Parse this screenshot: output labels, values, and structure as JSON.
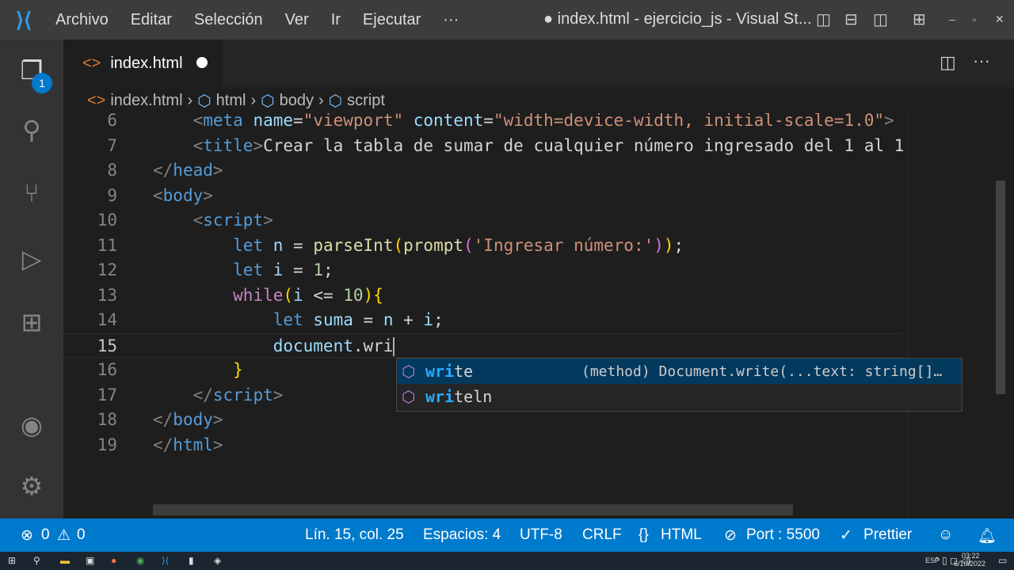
{
  "titlebar": {
    "menu": [
      "Archivo",
      "Editar",
      "Selección",
      "Ver",
      "Ir",
      "Ejecutar",
      "···"
    ],
    "title": "● index.html - ejercicio_js - Visual St..."
  },
  "activity": {
    "explorer_badge": "1"
  },
  "tab": {
    "label": "index.html"
  },
  "breadcrumb": [
    "index.html",
    "html",
    "body",
    "script"
  ],
  "editor": {
    "lines": [
      {
        "n": "6",
        "tokens": [
          [
            "    ",
            "p"
          ],
          [
            "<",
            "b"
          ],
          [
            "meta",
            "t"
          ],
          [
            " name",
            "a"
          ],
          [
            "=",
            "p"
          ],
          [
            "\"viewport\"",
            "s"
          ],
          [
            " content",
            "a"
          ],
          [
            "=",
            "p"
          ],
          [
            "\"width=device-width, initial-scale=1.0\"",
            "s"
          ],
          [
            ">",
            "b"
          ]
        ]
      },
      {
        "n": "7",
        "tokens": [
          [
            "    ",
            "p"
          ],
          [
            "<",
            "b"
          ],
          [
            "title",
            "t"
          ],
          [
            ">",
            "b"
          ],
          [
            "Crear la tabla de sumar de cualquier número ingresado del 1 al 1",
            "p"
          ]
        ]
      },
      {
        "n": "8",
        "tokens": [
          [
            "</",
            "b"
          ],
          [
            "head",
            "t"
          ],
          [
            ">",
            "b"
          ]
        ]
      },
      {
        "n": "9",
        "tokens": [
          [
            "<",
            "b"
          ],
          [
            "body",
            "t"
          ],
          [
            ">",
            "b"
          ]
        ]
      },
      {
        "n": "10",
        "tokens": [
          [
            "    ",
            "p"
          ],
          [
            "<",
            "b"
          ],
          [
            "script",
            "t"
          ],
          [
            ">",
            "b"
          ]
        ]
      },
      {
        "n": "11",
        "tokens": [
          [
            "        ",
            "p"
          ],
          [
            "let",
            "k"
          ],
          [
            " n ",
            "v"
          ],
          [
            "= ",
            "p"
          ],
          [
            "parseInt",
            "f"
          ],
          [
            "(",
            "y"
          ],
          [
            "prompt",
            "f"
          ],
          [
            "(",
            "m"
          ],
          [
            "'Ingresar número:'",
            "s"
          ],
          [
            ")",
            "m"
          ],
          [
            ")",
            "y"
          ],
          [
            ";",
            "p"
          ]
        ]
      },
      {
        "n": "12",
        "tokens": [
          [
            "        ",
            "p"
          ],
          [
            "let",
            "k"
          ],
          [
            " i ",
            "v"
          ],
          [
            "= ",
            "p"
          ],
          [
            "1",
            "n"
          ],
          [
            ";",
            "p"
          ]
        ]
      },
      {
        "n": "13",
        "tokens": [
          [
            "        ",
            "p"
          ],
          [
            "while",
            "w"
          ],
          [
            "(",
            "y"
          ],
          [
            "i",
            "v"
          ],
          [
            " <= ",
            "p"
          ],
          [
            "10",
            "n"
          ],
          [
            ")",
            "y"
          ],
          [
            "{",
            "y"
          ]
        ]
      },
      {
        "n": "14",
        "tokens": [
          [
            "            ",
            "p"
          ],
          [
            "let",
            "k"
          ],
          [
            " suma ",
            "v"
          ],
          [
            "= ",
            "p"
          ],
          [
            "n",
            "v"
          ],
          [
            " + ",
            "p"
          ],
          [
            "i",
            "v"
          ],
          [
            ";",
            "p"
          ]
        ]
      },
      {
        "n": "15",
        "tokens": [
          [
            "            ",
            "p"
          ],
          [
            "document",
            "v"
          ],
          [
            ".wri",
            "p"
          ]
        ]
      },
      {
        "n": "16",
        "tokens": [
          [
            "        ",
            "p"
          ],
          [
            "}",
            "y"
          ]
        ]
      },
      {
        "n": "17",
        "tokens": [
          [
            "    ",
            "p"
          ],
          [
            "</",
            "b"
          ],
          [
            "script",
            "t"
          ],
          [
            ">",
            "b"
          ]
        ]
      },
      {
        "n": "18",
        "tokens": [
          [
            "</",
            "b"
          ],
          [
            "body",
            "t"
          ],
          [
            ">",
            "b"
          ]
        ]
      },
      {
        "n": "19",
        "tokens": [
          [
            "</",
            "b"
          ],
          [
            "html",
            "t"
          ],
          [
            ">",
            "b"
          ]
        ]
      }
    ]
  },
  "suggest": [
    {
      "match": "wri",
      "rest": "te",
      "detail": "(method) Document.write(...text: string[]…"
    },
    {
      "match": "wri",
      "rest": "teln",
      "detail": ""
    }
  ],
  "status": {
    "errors": "0",
    "warnings": "0",
    "position": "Lín. 15, col. 25",
    "spaces": "Espacios: 4",
    "encoding": "UTF-8",
    "eol": "CRLF",
    "language": "HTML",
    "port": "Port : 5500",
    "prettier": "Prettier"
  },
  "taskbar": {
    "lang": "ESP",
    "time": "03:22",
    "date": "6/10/2022"
  }
}
